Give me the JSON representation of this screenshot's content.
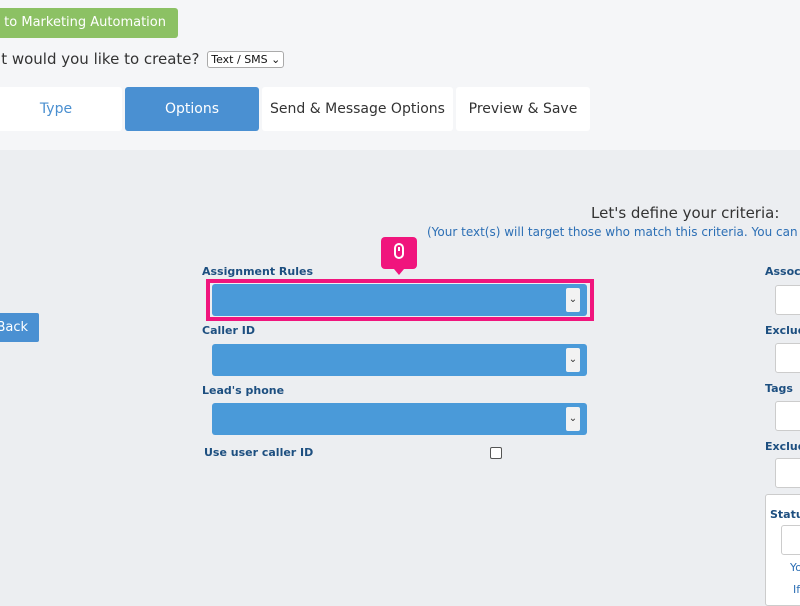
{
  "header": {
    "return_label": "turn to Marketing Automation",
    "create_prompt": "at would you like to create?",
    "create_type": "Text / SMS"
  },
  "tabs": [
    {
      "label": "Type"
    },
    {
      "label": "Options"
    },
    {
      "label": "Send & Message Options"
    },
    {
      "label": "Preview & Save"
    }
  ],
  "criteria": {
    "title": "Let's define your criteria:",
    "subtitle": "(Your text(s) will target those who match this criteria. You can also e"
  },
  "back_label": "Back",
  "fields": {
    "assignment_rules": "Assignment Rules",
    "caller_id": "Caller ID",
    "leads_phone": "Lead's phone",
    "use_user_caller_id": "Use user caller ID"
  },
  "right_panel": {
    "associ": "Associ",
    "exclud1": "Exclud",
    "tags": "Tags",
    "exclud2": "Exclud",
    "status": "Status",
    "status_text": "Yo",
    "status_text_2": "If"
  },
  "colors": {
    "accent": "#4a90d2",
    "select_blue": "#4a9ad9",
    "highlight": "#f0157d",
    "green": "#8cc164"
  },
  "icons": {
    "click_marker": "mouse-icon",
    "select_arrow": "chevron-down-icon"
  }
}
